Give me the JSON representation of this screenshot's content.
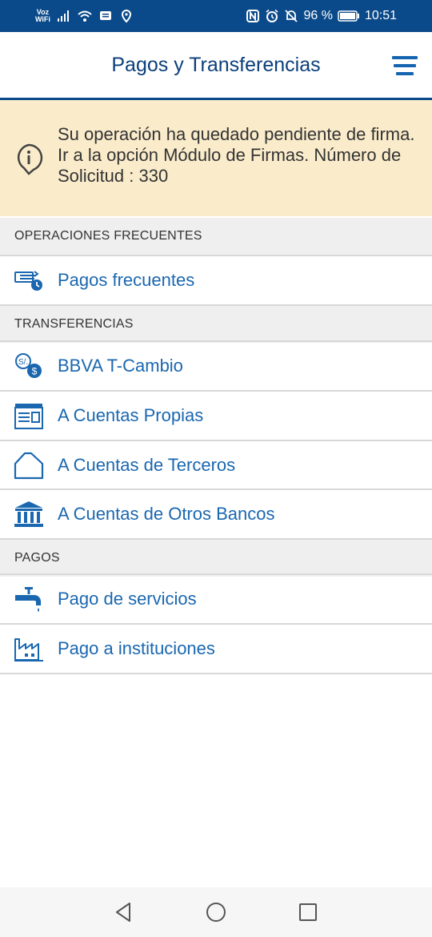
{
  "status_bar": {
    "network_label_top": "Voz",
    "network_label_bottom": "WiFi",
    "battery": "96 %",
    "time": "10:51"
  },
  "header": {
    "title": "Pagos y Transferencias"
  },
  "notice": {
    "text": "Su operación ha quedado pendiente de firma. Ir a la opción Módulo de Firmas. Número de Solicitud : 330"
  },
  "sections": {
    "frecuentes": {
      "title": "OPERACIONES FRECUENTES",
      "items": [
        {
          "label": "Pagos frecuentes",
          "icon": "frequent-payments-icon"
        }
      ]
    },
    "transferencias": {
      "title": "TRANSFERENCIAS",
      "items": [
        {
          "label": "BBVA T-Cambio",
          "icon": "currency-exchange-icon"
        },
        {
          "label": "A Cuentas Propias",
          "icon": "own-accounts-icon"
        },
        {
          "label": "A Cuentas de Terceros",
          "icon": "house-icon"
        },
        {
          "label": "A Cuentas de Otros Bancos",
          "icon": "bank-icon"
        }
      ]
    },
    "pagos": {
      "title": "PAGOS",
      "items": [
        {
          "label": "Pago de servicios",
          "icon": "faucet-icon"
        },
        {
          "label": "Pago a instituciones",
          "icon": "factory-icon"
        }
      ]
    }
  },
  "colors": {
    "brand_dark": "#0b4a8a",
    "title": "#0b3f7a",
    "link": "#1a67b0",
    "notice_bg": "#faeccb"
  }
}
